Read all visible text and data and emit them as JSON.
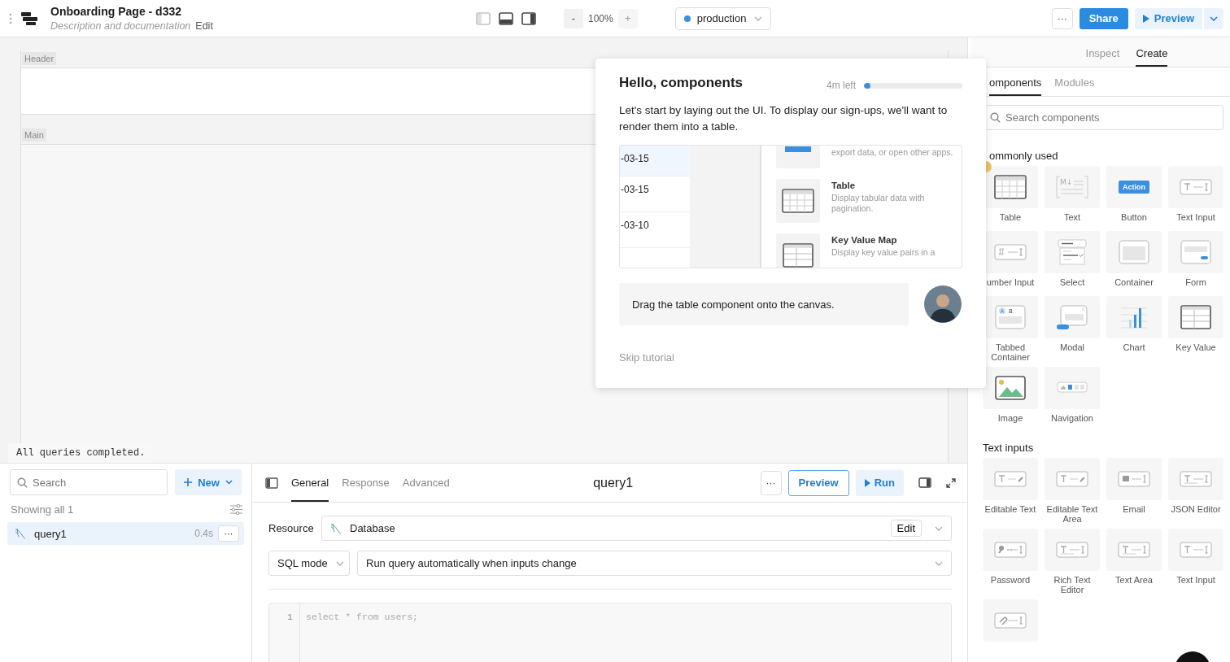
{
  "app": {
    "title": "Onboarding Page - d332",
    "subtitle": "Description and documentation",
    "edit": "Edit"
  },
  "toolbar": {
    "layout_toggles": [
      {
        "on": false
      },
      {
        "on": true
      },
      {
        "on": true
      }
    ],
    "zoom": {
      "minus": "-",
      "value": "100%",
      "plus": "+",
      "plus_disabled": true
    },
    "environment": {
      "label": "production",
      "color": "#3b8fe0"
    },
    "more": "···",
    "share": "Share",
    "preview": "Preview"
  },
  "canvas": {
    "sections": [
      {
        "label": "Header"
      },
      {
        "label": "Main"
      }
    ],
    "status": "All queries completed."
  },
  "tutorial": {
    "title": "Hello, components",
    "time_left": "4m left",
    "level": 0.07,
    "text": "Let's start by laying out the UI. To display our sign-ups, we'll want to render them into a table.",
    "preview_dates": [
      {
        "text": "-03-15",
        "selected": true
      },
      {
        "text": "-03-15",
        "selected": false
      },
      {
        "text": "-03-10",
        "selected": false
      }
    ],
    "preview_cards": [
      {
        "kind": "button",
        "description": "export data, or open other apps."
      },
      {
        "kind": "table",
        "title": "Table",
        "description": "Display tabular data with pagination."
      },
      {
        "kind": "keyvalue",
        "title": "Key Value Map",
        "description": "Display key value pairs in a"
      }
    ],
    "message": "Drag the table component onto the canvas.",
    "skip": "Skip tutorial"
  },
  "right_panel": {
    "tabs": [
      {
        "label": "Inspect",
        "selected": false
      },
      {
        "label": "Create",
        "selected": true
      }
    ],
    "subtabs": [
      {
        "label": "omponents",
        "selected": true
      },
      {
        "label": "Modules",
        "selected": false
      }
    ],
    "search": {
      "placeholder": "Search components"
    },
    "sections": [
      {
        "title": "ommonly used",
        "items": [
          {
            "kind": "table",
            "label": "Table"
          },
          {
            "kind": "text",
            "label": "Text",
            "glyph": "M↓"
          },
          {
            "kind": "button",
            "label": "Button",
            "badge": "Action"
          },
          {
            "kind": "input",
            "label": "Text Input"
          },
          {
            "kind": "number",
            "label": "umber Input"
          },
          {
            "kind": "select",
            "label": "Select"
          },
          {
            "kind": "container",
            "label": "Container"
          },
          {
            "kind": "form",
            "label": "Form"
          },
          {
            "kind": "tabs",
            "label": "Tabbed Container",
            "tabs": [
              "A",
              "B"
            ]
          },
          {
            "kind": "modal",
            "label": "Modal"
          },
          {
            "kind": "chart",
            "label": "Chart"
          },
          {
            "kind": "keyvalue",
            "label": "Key Value"
          },
          {
            "kind": "image",
            "label": "Image"
          },
          {
            "kind": "navigation",
            "label": "Navigation"
          }
        ]
      },
      {
        "title": "Text inputs",
        "items": [
          {
            "kind": "editable",
            "label": "Editable Text"
          },
          {
            "kind": "editable",
            "label": "Editable Text Area"
          },
          {
            "kind": "email",
            "label": "Email"
          },
          {
            "kind": "json",
            "label": "JSON Editor"
          },
          {
            "kind": "password",
            "label": "Password"
          },
          {
            "kind": "richtext",
            "label": "Rich Text Editor"
          },
          {
            "kind": "textarea",
            "label": "Text Area"
          },
          {
            "kind": "input",
            "label": "Text Input"
          },
          {
            "kind": "file"
          }
        ]
      }
    ]
  },
  "query_panel": {
    "search": {
      "placeholder": "Search"
    },
    "new": "New",
    "showing": "Showing all 1",
    "queries": [
      {
        "name": "query1",
        "time": "0.4s",
        "selected": true
      }
    ],
    "tabs": [
      {
        "label": "General",
        "selected": true
      },
      {
        "label": "Response",
        "selected": false
      },
      {
        "label": "Advanced",
        "selected": false
      }
    ],
    "title": "query1",
    "more": "···",
    "preview": "Preview",
    "run": "Run",
    "resource": {
      "label": "Resource",
      "value": "Database",
      "edit": "Edit"
    },
    "mode": "SQL mode",
    "trigger": "Run query automatically when inputs change",
    "code": [
      {
        "number": "1",
        "text": "select * from users;"
      }
    ]
  }
}
